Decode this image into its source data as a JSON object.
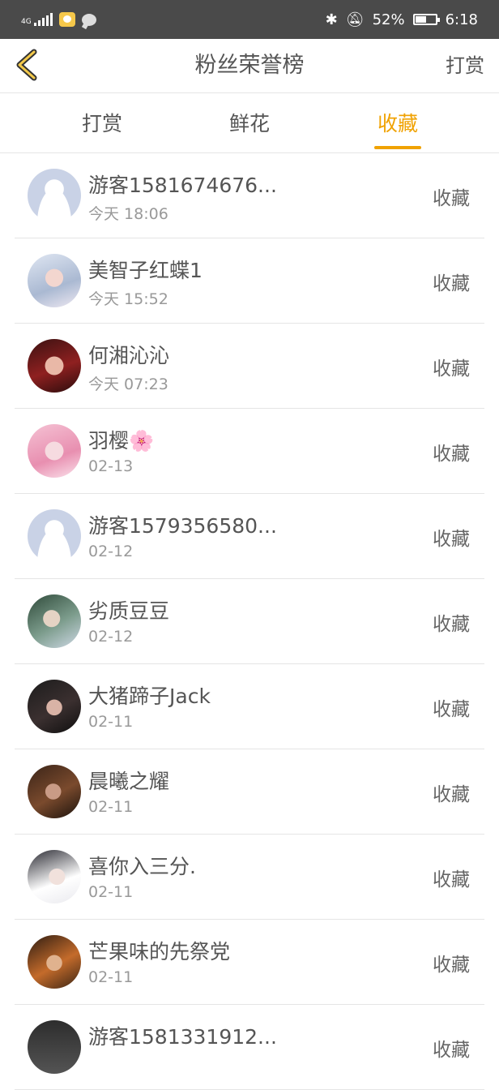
{
  "status_bar": {
    "network": "4G",
    "battery_percent": "52%",
    "time": "6:18"
  },
  "header": {
    "title": "粉丝荣誉榜",
    "right_action": "打赏"
  },
  "tabs": [
    {
      "label": "打赏",
      "active": false
    },
    {
      "label": "鲜花",
      "active": false
    },
    {
      "label": "收藏",
      "active": true
    }
  ],
  "rows": [
    {
      "name": "游客1581674676...",
      "date": "今天 18:06",
      "label": "收藏",
      "avatar": "default"
    },
    {
      "name": "美智子红蝶1",
      "date": "今天 15:52",
      "label": "收藏",
      "avatar": "anime-white-hair"
    },
    {
      "name": "何湘沁沁",
      "date": "今天 07:23",
      "label": "收藏",
      "avatar": "anime-red"
    },
    {
      "name": "羽樱🌸",
      "date": "02-13",
      "label": "收藏",
      "avatar": "anime-pink"
    },
    {
      "name": "游客1579356580...",
      "date": "02-12",
      "label": "收藏",
      "avatar": "default"
    },
    {
      "name": "劣质豆豆",
      "date": "02-12",
      "label": "收藏",
      "avatar": "photo-green"
    },
    {
      "name": "大猪蹄子Jack",
      "date": "02-11",
      "label": "收藏",
      "avatar": "anime-dark"
    },
    {
      "name": "晨曦之耀",
      "date": "02-11",
      "label": "收藏",
      "avatar": "anime-brown"
    },
    {
      "name": "喜你入三分.",
      "date": "02-11",
      "label": "收藏",
      "avatar": "anime-girl-light"
    },
    {
      "name": "芒果味的先祭党",
      "date": "02-11",
      "label": "收藏",
      "avatar": "anime-orange"
    },
    {
      "name": "游客1581331912...",
      "date": "",
      "label": "收藏",
      "avatar": "photo-dark"
    }
  ],
  "colors": {
    "accent": "#f0a202",
    "status_bar": "#4a4a4a",
    "text": "#555555",
    "subtext": "#999999"
  }
}
